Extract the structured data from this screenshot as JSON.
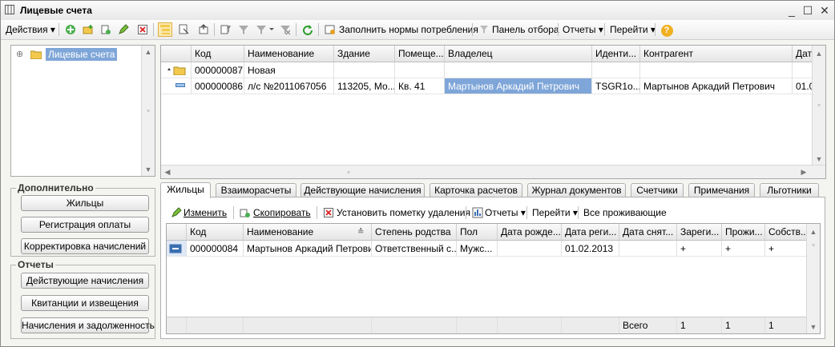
{
  "window": {
    "title": "Лицевые счета",
    "min": "_",
    "max": "☐",
    "close": "✕"
  },
  "toolbar": {
    "actions": "Действия ▾",
    "fill_norms": "Заполнить нормы потребления",
    "filter_panel": "Панель отбора",
    "reports": "Отчеты ▾",
    "goto": "Перейти ▾",
    "help": "?"
  },
  "tree": {
    "root_label": "Лицевые счета",
    "expander": "⊕"
  },
  "main_table": {
    "columns": [
      "Код",
      "Наименование",
      "Здание",
      "Помеще...",
      "Владелец",
      "Иденти...",
      "Контрагент",
      "Дата"
    ],
    "rows": [
      {
        "code": "000000087",
        "name": "Новая",
        "building": "",
        "room": "",
        "owner": "",
        "ident": "",
        "contractor": "",
        "date": ""
      },
      {
        "code": "000000086",
        "name": "л/с №2011067056",
        "building": "113205, Мо...",
        "room": "Кв. 41",
        "owner": "Мартынов Аркадий Петрович",
        "ident": "TSGR1o...",
        "contractor": "Мартынов Аркадий Петрович",
        "date": "01.0"
      }
    ]
  },
  "extra": {
    "legend": "Дополнительно",
    "buttons": [
      "Жильцы",
      "Регистрация оплаты",
      "Корректировка начислений"
    ]
  },
  "reports_box": {
    "legend": "Отчеты",
    "buttons": [
      "Действующие начисления",
      "Квитанции и извещения",
      "Начисления и задолженность"
    ]
  },
  "tabs": [
    "Жильцы",
    "Взаиморасчеты",
    "Действующие начисления",
    "Карточка расчетов",
    "Журнал документов",
    "Счетчики",
    "Примечания",
    "Льготники"
  ],
  "sub_toolbar": {
    "edit": "Изменить",
    "copy": "Скопировать",
    "mark_delete": "Установить пометку удаления",
    "reports": "Отчеты ▾",
    "goto": "Перейти ▾",
    "all_residents": "Все проживающие"
  },
  "residents_table": {
    "columns": [
      "Код",
      "Наименование",
      "Степень родства",
      "Пол",
      "Дата рожде...",
      "Дата реги...",
      "Дата снят...",
      "Зареги...",
      "Прожи...",
      "Собств..."
    ],
    "rows": [
      {
        "code": "000000084",
        "name": "Мартынов Аркадий Петрович",
        "relation": "Ответственный с...",
        "sex": "Мужс...",
        "birth": "",
        "reg": "01.02.2013",
        "unreg": "",
        "registered": "+",
        "living": "+",
        "owner": "+"
      }
    ],
    "footer": {
      "total_label": "Всего",
      "registered": "1",
      "living": "1",
      "owner": "1"
    }
  },
  "colors": {
    "selection": "#7fa6d8",
    "pressed": "#fbe8b0",
    "folder": "#f2c94c"
  }
}
